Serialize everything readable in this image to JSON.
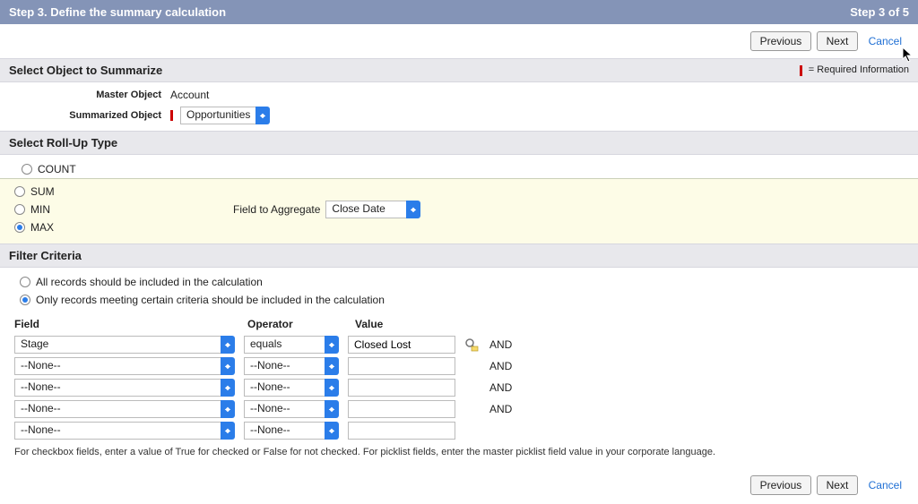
{
  "header": {
    "title": "Step 3. Define the summary calculation",
    "step_indicator": "Step 3 of 5"
  },
  "buttons": {
    "previous": "Previous",
    "next": "Next",
    "cancel": "Cancel"
  },
  "section_object": {
    "title": "Select Object to Summarize",
    "required_hint": "= Required Information",
    "master_label": "Master Object",
    "master_value": "Account",
    "summarized_label": "Summarized Object",
    "summarized_value": "Opportunities"
  },
  "section_rollup": {
    "title": "Select Roll-Up Type",
    "options": {
      "count": "COUNT",
      "sum": "SUM",
      "min": "MIN",
      "max": "MAX"
    },
    "selected": "max",
    "agg_field_label": "Field to Aggregate",
    "agg_field_value": "Close Date"
  },
  "section_filter": {
    "title": "Filter Criteria",
    "opt_all": "All records should be included in the calculation",
    "opt_criteria": "Only records meeting certain criteria should be included in the calculation",
    "selected": "criteria",
    "columns": {
      "field": "Field",
      "operator": "Operator",
      "value": "Value"
    },
    "and_label": "AND",
    "rows": [
      {
        "field": "Stage",
        "operator": "equals",
        "value": "Closed Lost",
        "lookup": true
      },
      {
        "field": "--None--",
        "operator": "--None--",
        "value": "",
        "lookup": false
      },
      {
        "field": "--None--",
        "operator": "--None--",
        "value": "",
        "lookup": false
      },
      {
        "field": "--None--",
        "operator": "--None--",
        "value": "",
        "lookup": false
      },
      {
        "field": "--None--",
        "operator": "--None--",
        "value": "",
        "lookup": false
      }
    ],
    "help_text": "For checkbox fields, enter a value of True for checked or False for not checked. For picklist fields, enter the master picklist field value in your corporate language."
  }
}
